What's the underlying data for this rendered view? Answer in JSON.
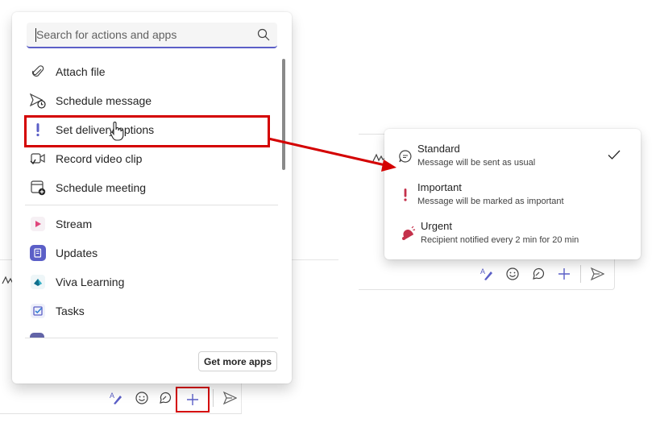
{
  "actions_menu": {
    "search": {
      "placeholder": "Search for actions and apps"
    },
    "items": [
      {
        "label": "Attach file",
        "icon": "paperclip-icon"
      },
      {
        "label": "Schedule message",
        "icon": "schedule-send-icon"
      },
      {
        "label": "Set delivery options",
        "icon": "exclamation-icon"
      },
      {
        "label": "Record video clip",
        "icon": "video-clip-icon"
      },
      {
        "label": "Schedule meeting",
        "icon": "calendar-add-icon"
      }
    ],
    "apps": [
      {
        "label": "Stream",
        "icon": "stream-app-icon"
      },
      {
        "label": "Updates",
        "icon": "updates-app-icon"
      },
      {
        "label": "Viva Learning",
        "icon": "viva-learning-app-icon"
      },
      {
        "label": "Tasks",
        "icon": "tasks-app-icon"
      }
    ],
    "get_more_label": "Get more apps"
  },
  "priority_menu": {
    "options": [
      {
        "title": "Standard",
        "description": "Message will be sent as usual",
        "icon": "chat-bubble-icon",
        "selected": true
      },
      {
        "title": "Important",
        "description": "Message will be marked as important",
        "icon": "exclamation-icon",
        "selected": false
      },
      {
        "title": "Urgent",
        "description": "Recipient notified every 2 min for 20 min",
        "icon": "bell-alert-icon",
        "selected": false
      }
    ]
  },
  "compose_toolbar": {
    "buttons": [
      "format-icon",
      "emoji-icon",
      "loop-icon",
      "plus-icon",
      "send-icon"
    ]
  },
  "colors": {
    "accent": "#5b5fc7",
    "highlight": "#d40000",
    "important": "#c4314b"
  }
}
